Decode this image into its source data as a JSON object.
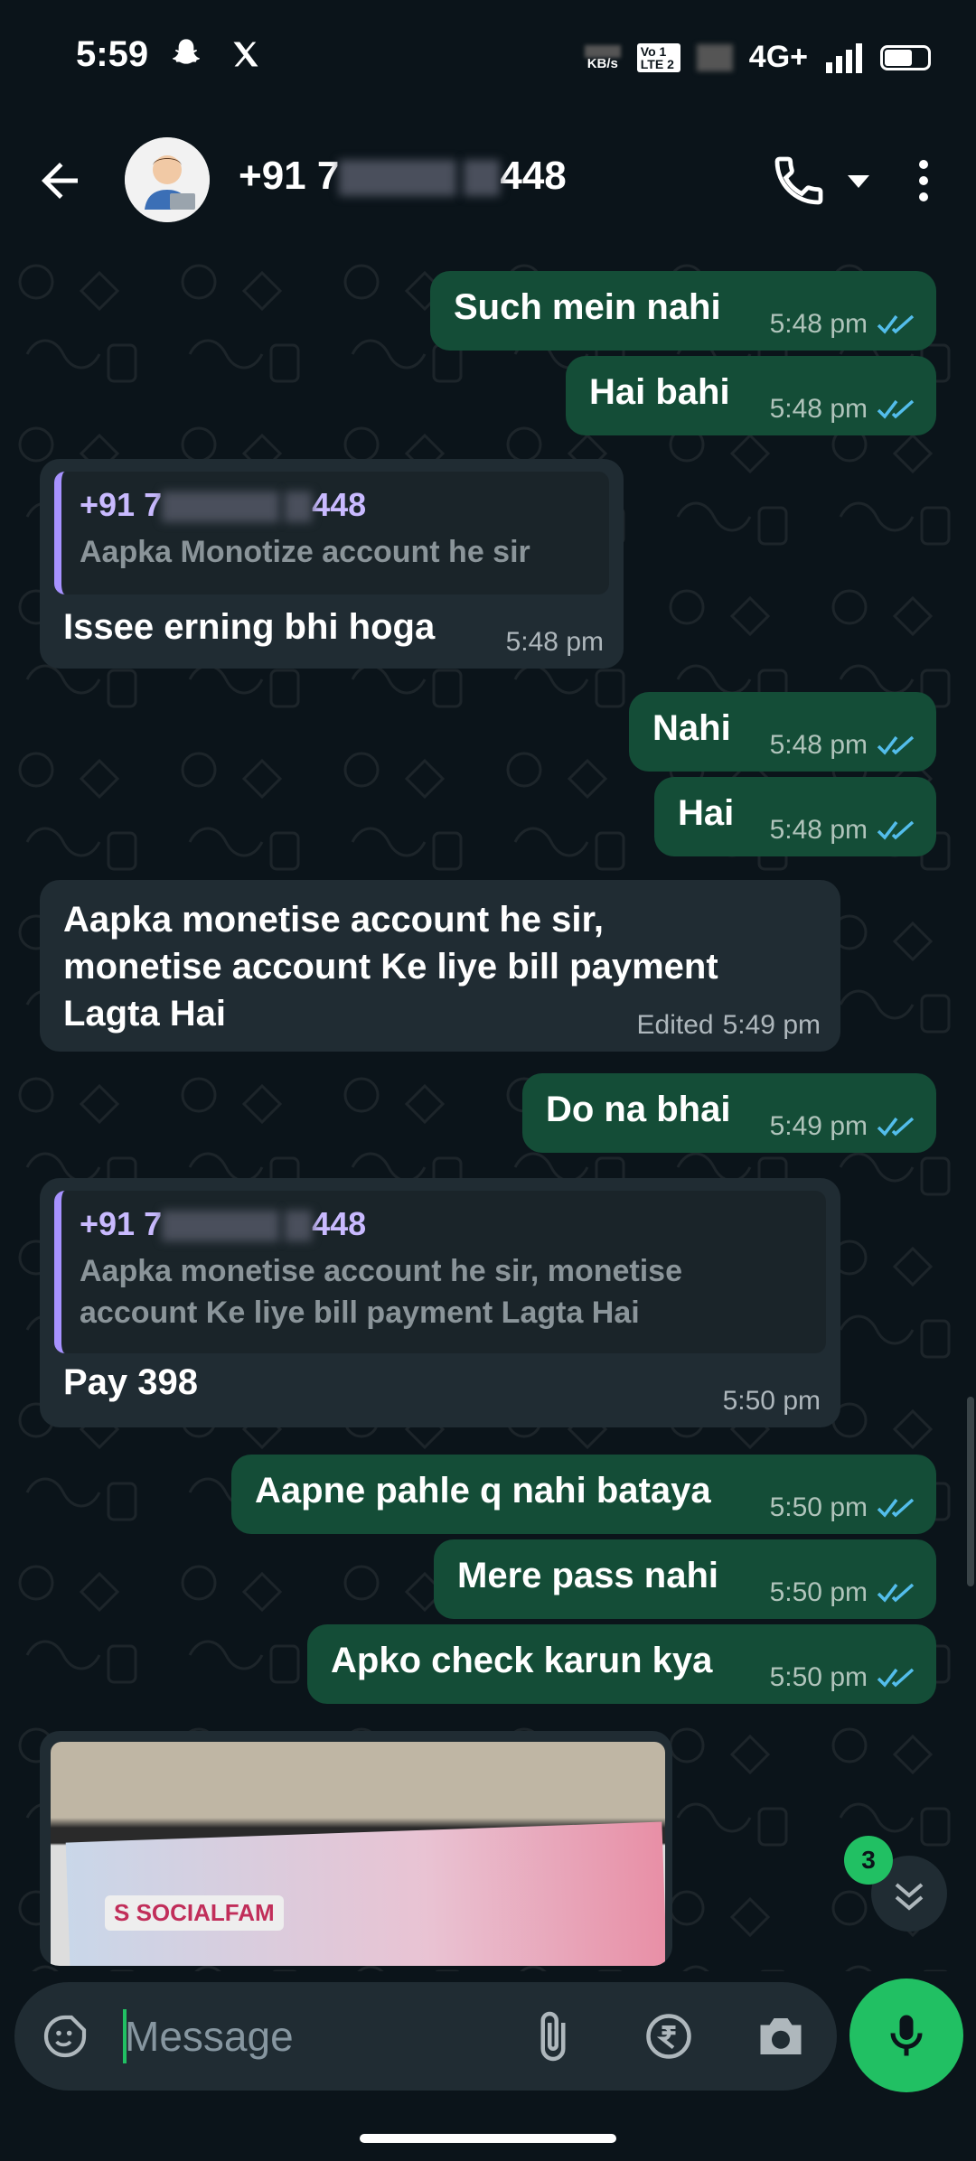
{
  "status_bar": {
    "time": "5:59",
    "speed_unit": "KB/s",
    "volte": "Vo 1 LTE 2",
    "network": "4G+",
    "icons": [
      "snapchat-icon",
      "x-icon",
      "signal-icon",
      "battery-icon"
    ]
  },
  "header": {
    "contact_prefix": "+91 7",
    "contact_suffix": "448",
    "icons": [
      "back-arrow-icon",
      "phone-icon",
      "dropdown-icon",
      "more-vert-icon"
    ]
  },
  "messages": [
    {
      "direction": "out",
      "text": "Such mein nahi",
      "time": "5:48 pm",
      "ticks": "read"
    },
    {
      "direction": "out",
      "text": "Hai bahi",
      "time": "5:48 pm",
      "ticks": "read"
    },
    {
      "direction": "in",
      "quote_name_prefix": "+91 7",
      "quote_name_suffix": "448",
      "quote_text": "Aapka Monotize account he sir",
      "text": "Issee erning bhi hoga",
      "time": "5:48 pm"
    },
    {
      "direction": "out",
      "text": "Nahi",
      "time": "5:48 pm",
      "ticks": "read"
    },
    {
      "direction": "out",
      "text": "Hai",
      "time": "5:48 pm",
      "ticks": "read"
    },
    {
      "direction": "in",
      "text_lines": [
        "Aapka monetise account he sir,",
        "monetise account Ke liye bill payment",
        "Lagta Hai"
      ],
      "edited_label": "Edited",
      "time": "5:49 pm"
    },
    {
      "direction": "out",
      "text": "Do na bhai",
      "time": "5:49 pm",
      "ticks": "read"
    },
    {
      "direction": "in",
      "quote_name_prefix": "+91 7",
      "quote_name_suffix": "448",
      "quote_text_lines": [
        "Aapka monetise account he sir, monetise",
        "account Ke liye bill payment Lagta Hai"
      ],
      "text": "Pay 398",
      "time": "5:50 pm"
    },
    {
      "direction": "out",
      "text": "Aapne pahle q nahi bataya",
      "time": "5:50 pm",
      "ticks": "read"
    },
    {
      "direction": "out",
      "text": "Mere pass nahi",
      "time": "5:50 pm",
      "ticks": "read"
    },
    {
      "direction": "out",
      "text": "Apko check karun kya",
      "time": "5:50 pm",
      "ticks": "read"
    }
  ],
  "image_message": {
    "logo_text": "S SOCIALFAM"
  },
  "scroll_down": {
    "unread_count": "3"
  },
  "composer": {
    "placeholder": "Message"
  },
  "colors": {
    "background": "#0b141a",
    "outgoing_bubble": "#144d37",
    "incoming_bubble": "#202c33",
    "accent": "#21c063",
    "read_tick": "#53bdeb",
    "quote_bar": "#a792ff"
  }
}
